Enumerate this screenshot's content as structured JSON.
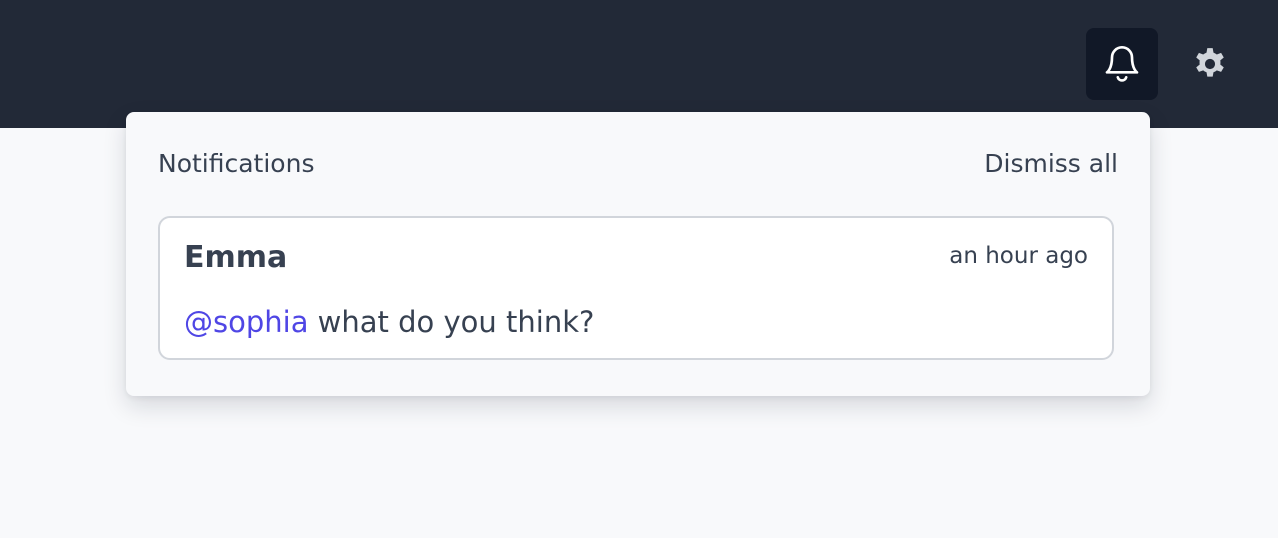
{
  "topbar": {
    "bell_icon": "bell-icon",
    "gear_icon": "gear-icon"
  },
  "notifications": {
    "title": "Notifications",
    "dismiss_all_label": "Dismiss all",
    "items": [
      {
        "author": "Emma",
        "time": "an hour ago",
        "mention": "@sophia",
        "text": " what do you think?"
      }
    ]
  },
  "colors": {
    "topbar": "#222937",
    "active_button": "#111827",
    "mention": "#4f46e5",
    "text": "#374151"
  }
}
